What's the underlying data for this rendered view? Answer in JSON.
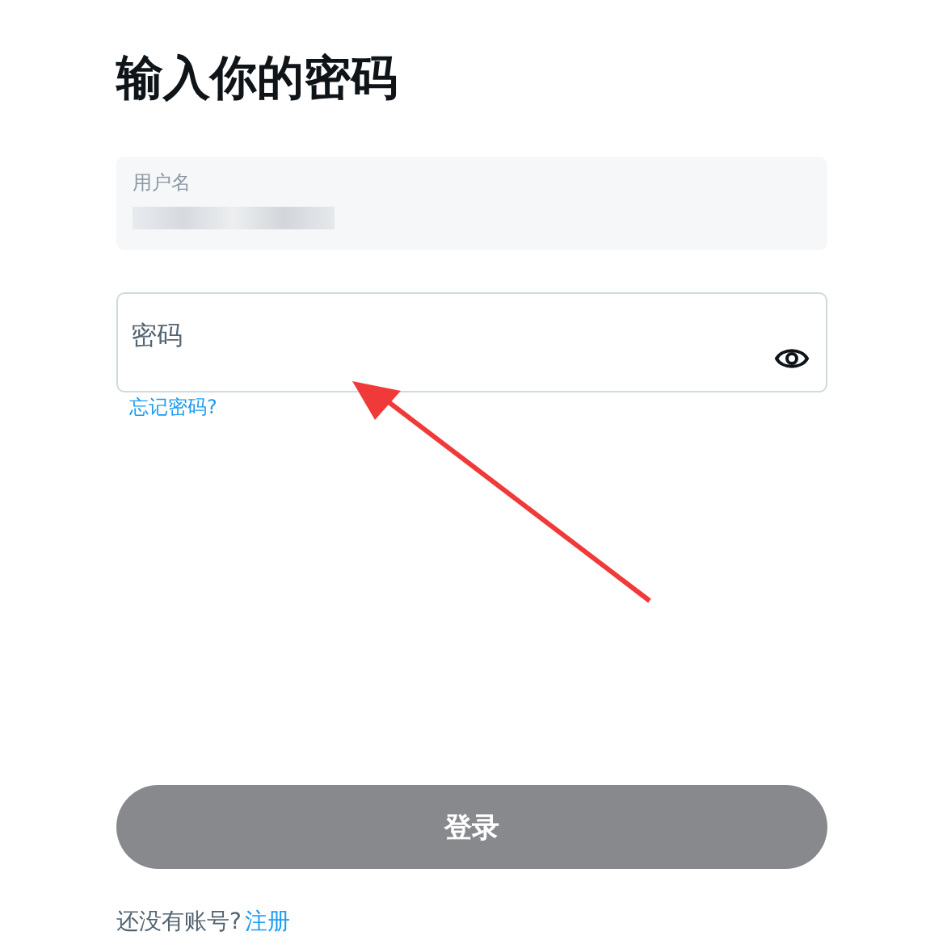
{
  "title": "输入你的密码",
  "username_field": {
    "label": "用户名",
    "value_redacted": true,
    "disabled": true
  },
  "password_field": {
    "placeholder": "密码"
  },
  "forgot_link": "忘记密码?",
  "login_button": {
    "label": "登录",
    "disabled": true
  },
  "footer": {
    "text": "还没有账号?",
    "link": "注册"
  }
}
